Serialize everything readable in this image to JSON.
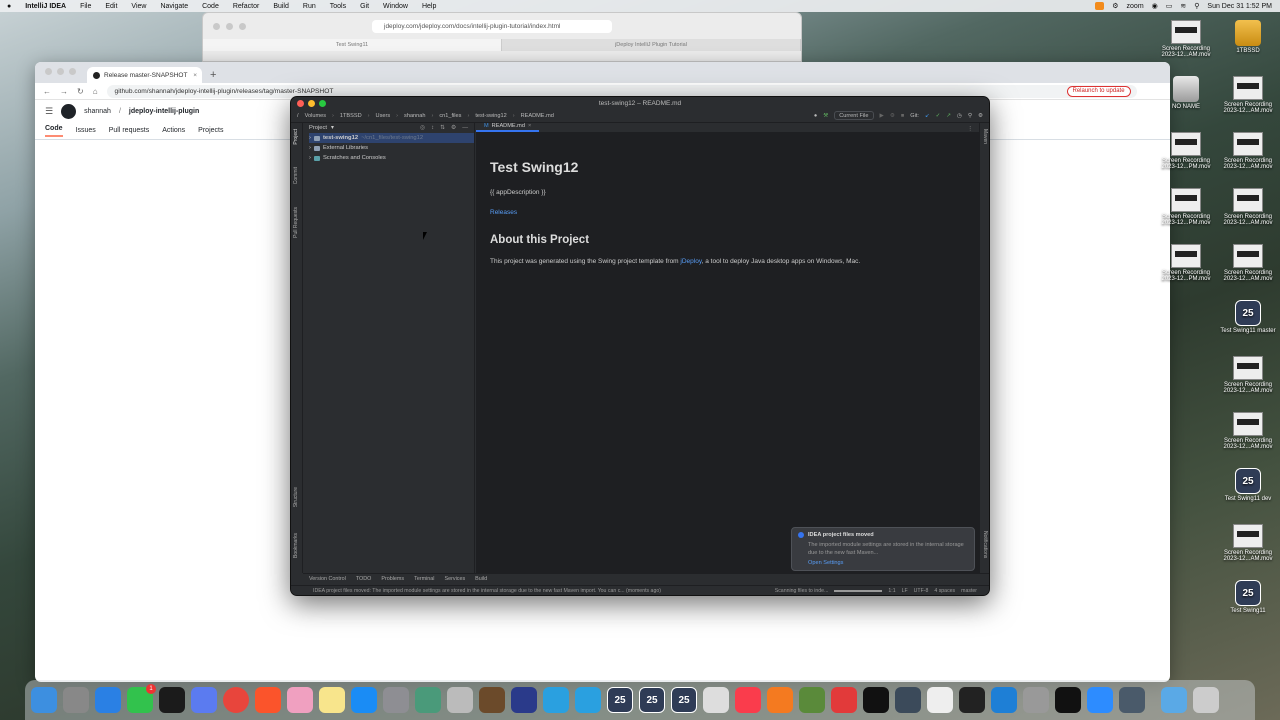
{
  "menubar": {
    "apple": "",
    "app_name": "IntelliJ IDEA",
    "items": [
      "File",
      "Edit",
      "View",
      "Navigate",
      "Code",
      "Refactor",
      "Build",
      "Run",
      "Tools",
      "Git",
      "Window",
      "Help"
    ],
    "zoom": "zoom",
    "clock": "Sun Dec 31  1:52 PM"
  },
  "safari": {
    "url": "jdeploy.com/jdeploy.com/docs/intellij-plugin-tutorial/index.html",
    "tabs": [
      "Test Swing11",
      "jDeploy IntelliJ Plugin Tutorial"
    ]
  },
  "chrome": {
    "tab_title": "Release master-SNAPSHOT",
    "url": "github.com/shannah/jdeploy-intellij-plugin/releases/tag/master-SNAPSHOT",
    "relaunch": "Relaunch to update",
    "gh_owner": "shannah",
    "gh_repo": "jdeploy-intellij-plugin",
    "gh_tabs": [
      "Code",
      "Issues",
      "Pull requests",
      "Actions",
      "Projects"
    ]
  },
  "idea": {
    "window_title": "test-swing12 – README.md",
    "breadcrumb": [
      "/",
      "Volumes",
      "1TBSSD",
      "Users",
      "shannah",
      "cn1_files",
      "test-swing12",
      "README.md"
    ],
    "run_config": "Current File",
    "git_label": "Git:",
    "project_label": "Project",
    "tree": [
      {
        "name": "test-swing12",
        "path": "~/cn1_files/test-swing12"
      },
      {
        "name": "External Libraries",
        "path": ""
      },
      {
        "name": "Scratches and Consoles",
        "path": ""
      }
    ],
    "left_tools": [
      "Project",
      "Commit",
      "Pull Requests",
      "Structure",
      "Bookmarks"
    ],
    "right_tools": [
      "Maven",
      "Notifications"
    ],
    "editor_tab": "README.md",
    "readme": {
      "h1": "Test Swing12",
      "app_description": "{{ appDescription }}",
      "releases_link": "Releases",
      "h2": "About this Project",
      "body_prefix": "This project was generated using the Swing project template from ",
      "body_link": "jDeploy",
      "body_suffix": ", a tool to deploy Java desktop apps on Windows, Mac."
    },
    "notification": {
      "title": "IDEA project files moved",
      "body": "The imported module settings are stored in the internal storage due to the new fast Maven...",
      "action": "Open Settings"
    },
    "bottom_tools": [
      "Version Control",
      "TODO",
      "Problems",
      "Terminal",
      "Services",
      "Build"
    ],
    "status": {
      "message": "IDEA project files moved: The imported module settings are stored in the internal storage due to the new fast Maven import. You can c... (moments ago)",
      "task": "Scanning files to inde...",
      "position": "1:1",
      "line_sep": "LF",
      "encoding": "UTF-8",
      "indent": "4 spaces",
      "branch": "master"
    }
  },
  "desktop": [
    {
      "label": "Screen Recording 2023-12...AM.mov",
      "kind": "thumb"
    },
    {
      "label": "1TBSSD",
      "kind": "drive"
    },
    {
      "label": "NO NAME",
      "kind": "drive2"
    },
    {
      "label": "Screen Recording 2023-12...AM.mov",
      "kind": "thumb"
    },
    {
      "label": "Screen Recording 2023-12...PM.mov",
      "kind": "thumb"
    },
    {
      "label": "Screen Recording 2023-12...AM.mov",
      "kind": "thumb"
    },
    {
      "label": "Screen Recording 2023-12...PM.mov",
      "kind": "thumb"
    },
    {
      "label": "Screen Recording 2023-12...AM.mov",
      "kind": "thumb"
    },
    {
      "label": "Screen Recording 2023-12...PM.mov",
      "kind": "thumb"
    },
    {
      "label": "Screen Recording 2023-12...AM.mov",
      "kind": "thumb"
    },
    {
      "label": "Test Swing11 master",
      "kind": "cal"
    },
    {
      "label": "Screen Recording 2023-12...AM.mov",
      "kind": "thumb"
    },
    {
      "label": "Screen Recording 2023-12...AM.mov",
      "kind": "thumb"
    },
    {
      "label": "Test Swing11 dev",
      "kind": "cal"
    },
    {
      "label": "Screen Recording 2023-12...AM.mov",
      "kind": "thumb"
    },
    {
      "label": "Test Swing11",
      "kind": "cal"
    }
  ],
  "calendar_day": "25",
  "dock_badge": "1",
  "colors": {
    "idea_bg": "#2b2d30",
    "editor_bg": "#1e1f22",
    "link": "#589df6",
    "accent": "#3574f0"
  }
}
